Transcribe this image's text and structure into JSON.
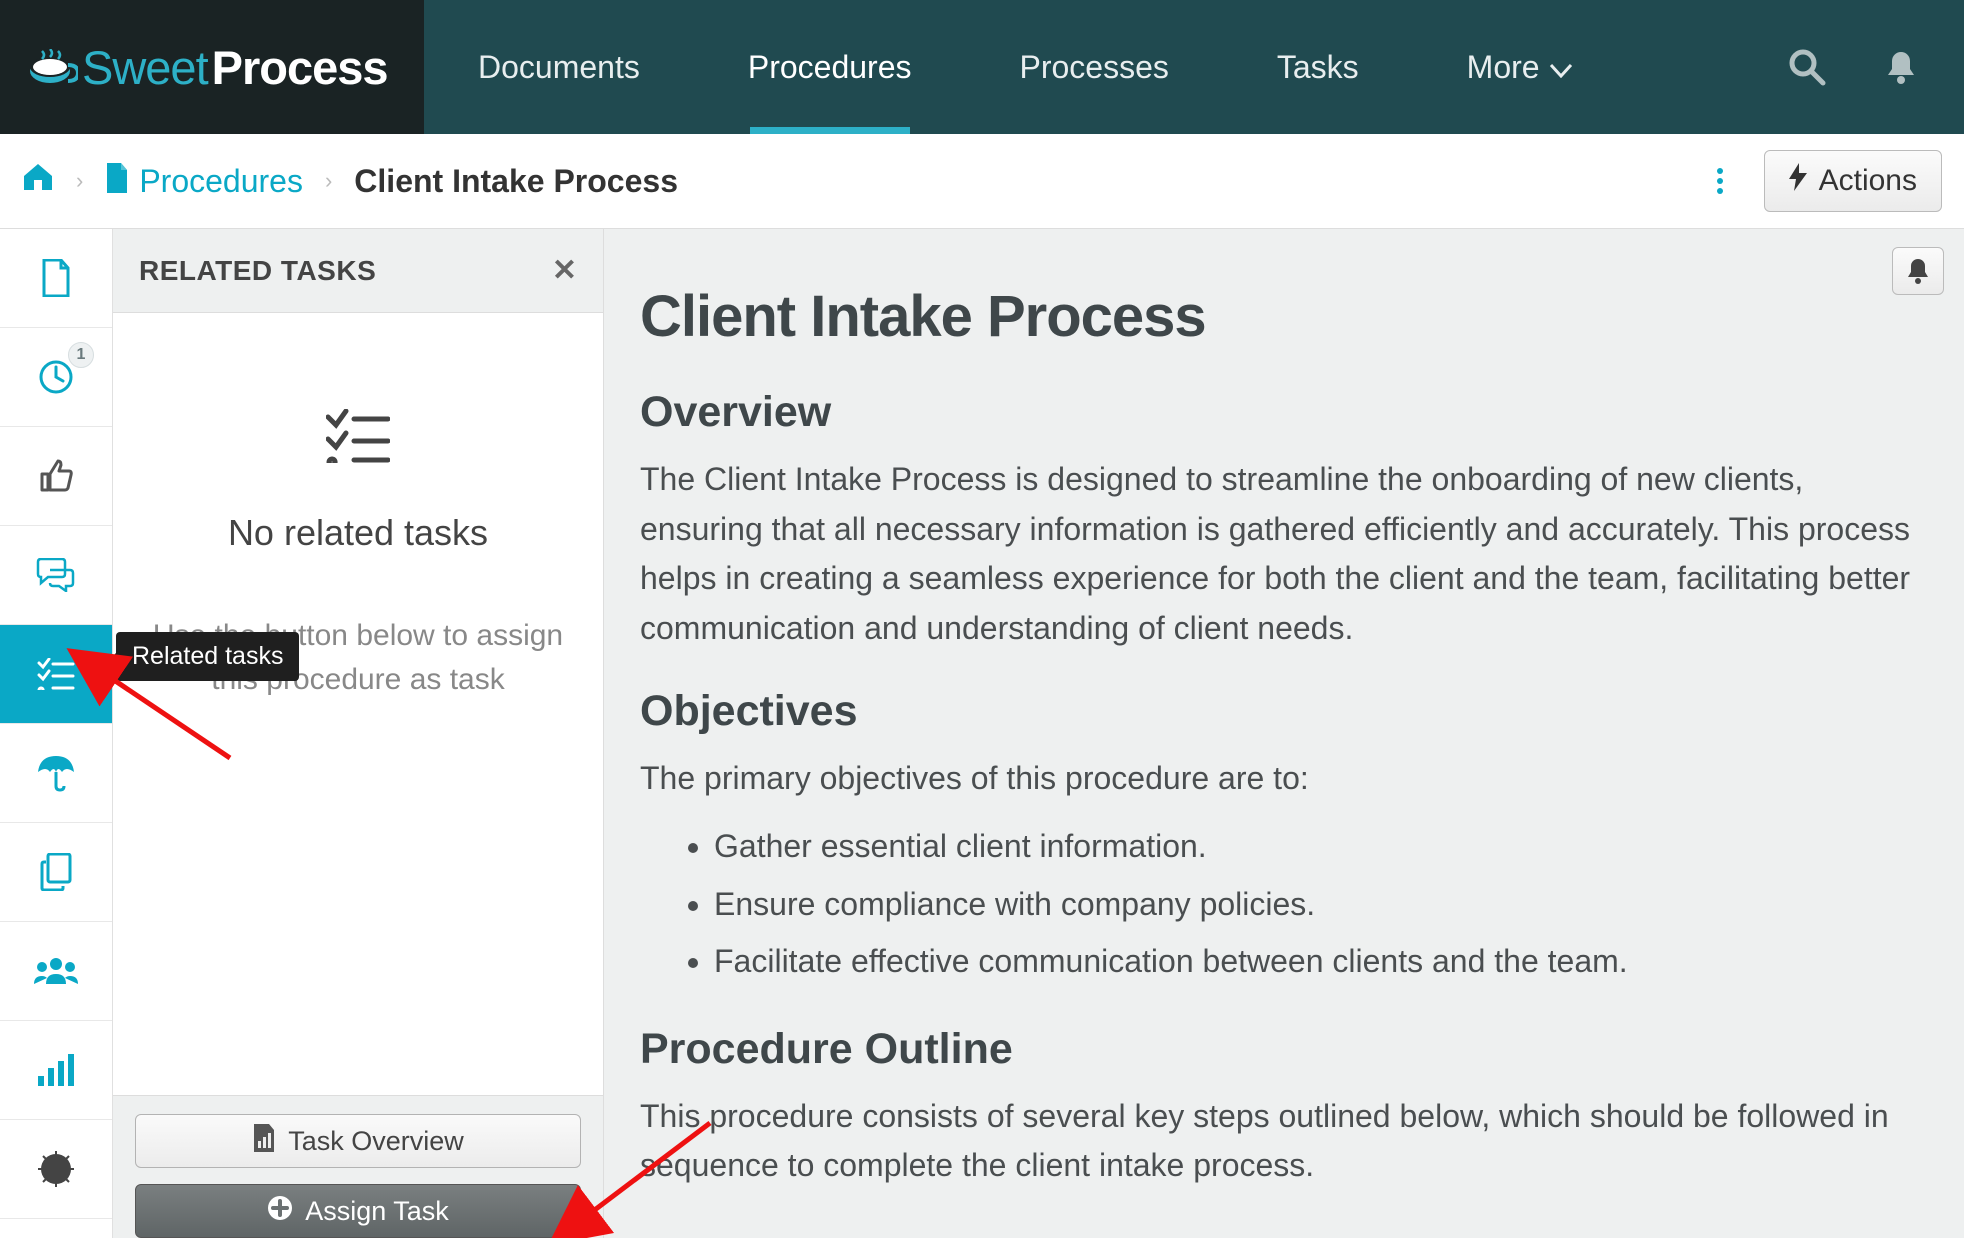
{
  "brand": {
    "name_light": "Sweet",
    "name_bold": "Process"
  },
  "nav": {
    "items": [
      {
        "label": "Documents"
      },
      {
        "label": "Procedures"
      },
      {
        "label": "Processes"
      },
      {
        "label": "Tasks"
      },
      {
        "label": "More"
      }
    ],
    "active_index": 1
  },
  "breadcrumb": {
    "link": "Procedures",
    "current": "Client Intake Process",
    "actions_label": "Actions"
  },
  "rail": {
    "badge_count": "1",
    "tooltip": "Related tasks"
  },
  "tasks_panel": {
    "title": "RELATED TASKS",
    "empty_title": "No related tasks",
    "empty_sub": "Use the button below to assign this procedure as task",
    "overview_btn": "Task Overview",
    "assign_btn": "Assign Task"
  },
  "doc": {
    "title": "Client Intake Process",
    "overview_h": "Overview",
    "overview_p": "The Client Intake Process is designed to streamline the onboarding of new clients, ensuring that all necessary information is gathered efficiently and accurately. This process helps in creating a seamless experience for both the client and the team, facilitating better communication and understanding of client needs.",
    "objectives_h": "Objectives",
    "objectives_p": "The primary objectives of this procedure are to:",
    "objectives": [
      "Gather essential client information.",
      "Ensure compliance with company policies.",
      "Facilitate effective communication between clients and the team."
    ],
    "outline_h": "Procedure Outline",
    "outline_p": "This procedure consists of several key steps outlined below, which should be followed in sequence to complete the client intake process."
  }
}
